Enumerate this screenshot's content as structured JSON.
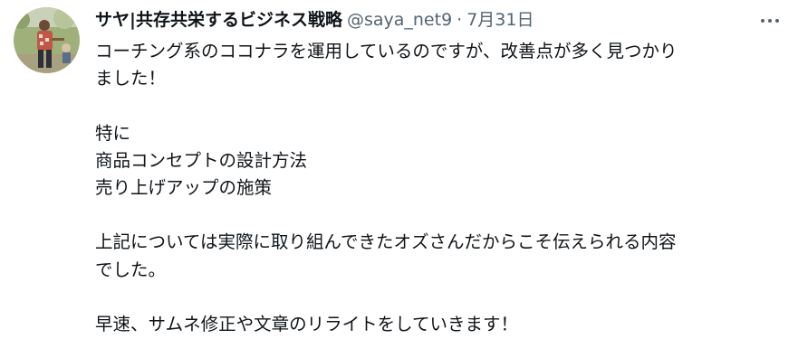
{
  "tweet": {
    "author": {
      "display_name": "サヤ|共存共栄するビジネス戦略",
      "handle": "@saya_net9",
      "avatar": "profile-photo"
    },
    "separator": "·",
    "date": "7月31日",
    "more_icon": "more-horizontal-icon",
    "paragraphs": [
      [
        "コーチング系のココナラを運用しているのですが、改善点が多く見つかり",
        "ました！"
      ],
      [
        "特に",
        "商品コンセプトの設計方法",
        "売り上げアップの施策"
      ],
      [
        "上記については実際に取り組んできたオズさんだからこそ伝えられる内容",
        "でした。"
      ],
      [
        "早速、サムネ修正や文章のリライトをしていきます！"
      ]
    ]
  }
}
